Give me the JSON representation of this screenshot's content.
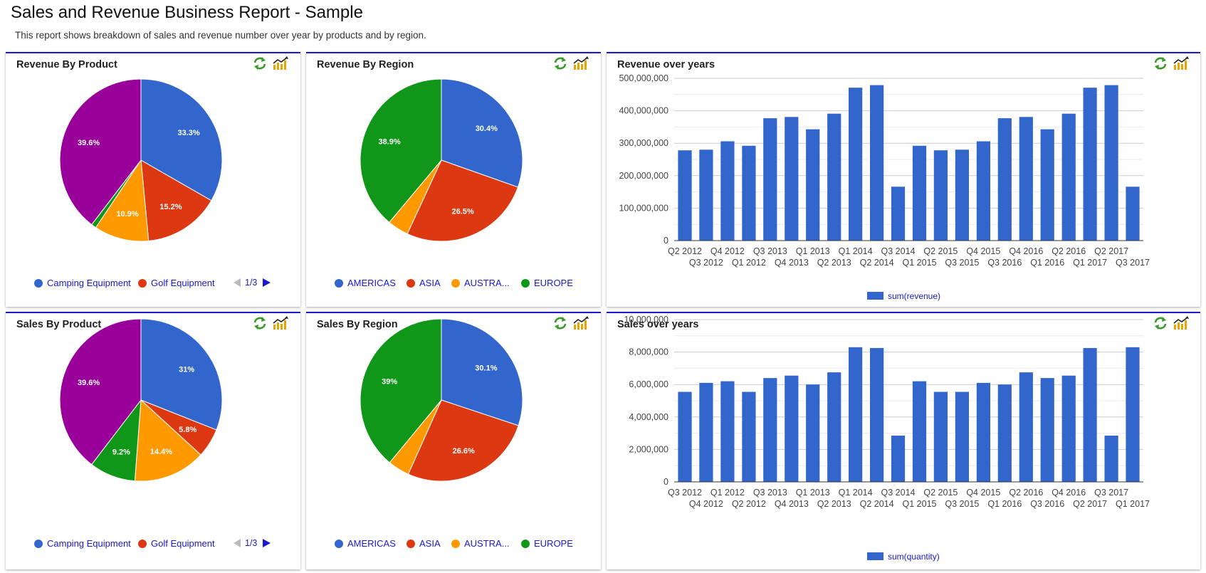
{
  "page": {
    "title": "Sales and Revenue Business Report - Sample",
    "description": "This report shows breakdown of sales and revenue number over year by products and by region."
  },
  "icons": {
    "refresh": "refresh-icon",
    "chart_type": "chart-type-icon",
    "prev": "prev-page-icon",
    "next": "next-page-icon"
  },
  "colors": {
    "blue": "#3366cc",
    "red": "#dc3912",
    "orange": "#ff9900",
    "green": "#109618",
    "purple": "#990099",
    "teal": "#0099c6",
    "link": "#1a1acc",
    "header_border": "#1a1acc"
  },
  "panels": {
    "revenue_by_product": {
      "title": "Revenue By Product",
      "legend": [
        "Camping Equipment",
        "Golf Equipment"
      ],
      "pager": "1/3"
    },
    "revenue_by_region": {
      "title": "Revenue By Region",
      "legend": [
        "AMERICAS",
        "ASIA",
        "AUSTRA...",
        "EUROPE"
      ]
    },
    "revenue_over_years": {
      "title": "Revenue over years",
      "legend": "sum(revenue)"
    },
    "sales_by_product": {
      "title": "Sales By Product",
      "legend": [
        "Camping Equipment",
        "Golf Equipment"
      ],
      "pager": "1/3"
    },
    "sales_by_region": {
      "title": "Sales By Region",
      "legend": [
        "AMERICAS",
        "ASIA",
        "AUSTRA...",
        "EUROPE"
      ]
    },
    "sales_over_years": {
      "title": "Sales over years",
      "legend": "sum(quantity)"
    }
  },
  "chart_data": [
    {
      "type": "pie",
      "title": "Revenue By Product",
      "slices": [
        {
          "value": 33.3,
          "label": "33.3%",
          "color": "#3366cc"
        },
        {
          "value": 15.2,
          "label": "15.2%",
          "color": "#dc3912"
        },
        {
          "value": 10.9,
          "label": "10.9%",
          "color": "#ff9900"
        },
        {
          "value": 1.0,
          "label": "",
          "color": "#109618"
        },
        {
          "value": 39.6,
          "label": "39.6%",
          "color": "#990099"
        }
      ]
    },
    {
      "type": "pie",
      "title": "Revenue By Region",
      "slices": [
        {
          "name": "AMERICAS",
          "value": 30.4,
          "label": "30.4%",
          "color": "#3366cc"
        },
        {
          "name": "ASIA",
          "value": 26.5,
          "label": "26.5%",
          "color": "#dc3912"
        },
        {
          "name": "AUSTRA...",
          "value": 4.2,
          "label": "",
          "color": "#ff9900"
        },
        {
          "name": "EUROPE",
          "value": 38.9,
          "label": "38.9%",
          "color": "#109618"
        }
      ]
    },
    {
      "type": "bar",
      "title": "Revenue over years",
      "series_name": "sum(revenue)",
      "categories": [
        "Q2 2012",
        "Q3 2012",
        "Q4 2012",
        "Q1 2012",
        "Q3 2013",
        "Q4 2013",
        "Q1 2013",
        "Q2 2013",
        "Q1 2014",
        "Q2 2014",
        "Q3 2014",
        "Q1 2015",
        "Q2 2015",
        "Q3 2015",
        "Q4 2015",
        "Q3 2016",
        "Q4 2016",
        "Q1 2016",
        "Q2 2016",
        "Q1 2017",
        "Q2 2017",
        "Q3 2017"
      ],
      "values": [
        278000000,
        280000000,
        306000000,
        292000000,
        377000000,
        381000000,
        343000000,
        391000000,
        471000000,
        479000000,
        166000000,
        292000000,
        278000000,
        280000000,
        306000000,
        377000000,
        381000000,
        343000000,
        391000000,
        471000000,
        479000000,
        166000000
      ],
      "yticks": [
        "0",
        "100,000,000",
        "200,000,000",
        "300,000,000",
        "400,000,000",
        "500,000,000"
      ],
      "ylim": [
        0,
        500000000
      ],
      "grid": true,
      "legend_position": "bottom"
    },
    {
      "type": "pie",
      "title": "Sales By Product",
      "slices": [
        {
          "value": 31.0,
          "label": "31%",
          "color": "#3366cc"
        },
        {
          "value": 5.8,
          "label": "5.8%",
          "color": "#dc3912"
        },
        {
          "value": 14.4,
          "label": "14.4%",
          "color": "#ff9900"
        },
        {
          "value": 9.2,
          "label": "9.2%",
          "color": "#109618"
        },
        {
          "value": 39.6,
          "label": "39.6%",
          "color": "#990099"
        }
      ]
    },
    {
      "type": "pie",
      "title": "Sales By Region",
      "slices": [
        {
          "name": "AMERICAS",
          "value": 30.1,
          "label": "30.1%",
          "color": "#3366cc"
        },
        {
          "name": "ASIA",
          "value": 26.6,
          "label": "26.6%",
          "color": "#dc3912"
        },
        {
          "name": "AUSTRA...",
          "value": 4.3,
          "label": "",
          "color": "#ff9900"
        },
        {
          "name": "EUROPE",
          "value": 39.0,
          "label": "39%",
          "color": "#109618"
        }
      ]
    },
    {
      "type": "bar",
      "title": "Sales over years",
      "series_name": "sum(quantity)",
      "categories": [
        "Q3 2012",
        "Q4 2012",
        "Q1 2012",
        "Q2 2012",
        "Q3 2013",
        "Q4 2013",
        "Q1 2013",
        "Q2 2013",
        "Q1 2014",
        "Q2 2014",
        "Q3 2014",
        "Q1 2015",
        "Q2 2015",
        "Q3 2015",
        "Q4 2015",
        "Q1 2016",
        "Q2 2016",
        "Q3 2016",
        "Q4 2016",
        "Q2 2017",
        "Q3 2017",
        "Q1 2017"
      ],
      "values": [
        5550000,
        6100000,
        6200000,
        5550000,
        6400000,
        6550000,
        6000000,
        6750000,
        8300000,
        8250000,
        2850000,
        6200000,
        5550000,
        5550000,
        6100000,
        6000000,
        6750000,
        6400000,
        6550000,
        8250000,
        2850000,
        8300000
      ],
      "yticks": [
        "0",
        "2,000,000",
        "4,000,000",
        "6,000,000",
        "8,000,000",
        "10,000,000"
      ],
      "ylim": [
        0,
        10000000
      ],
      "grid": true,
      "legend_position": "bottom"
    }
  ]
}
